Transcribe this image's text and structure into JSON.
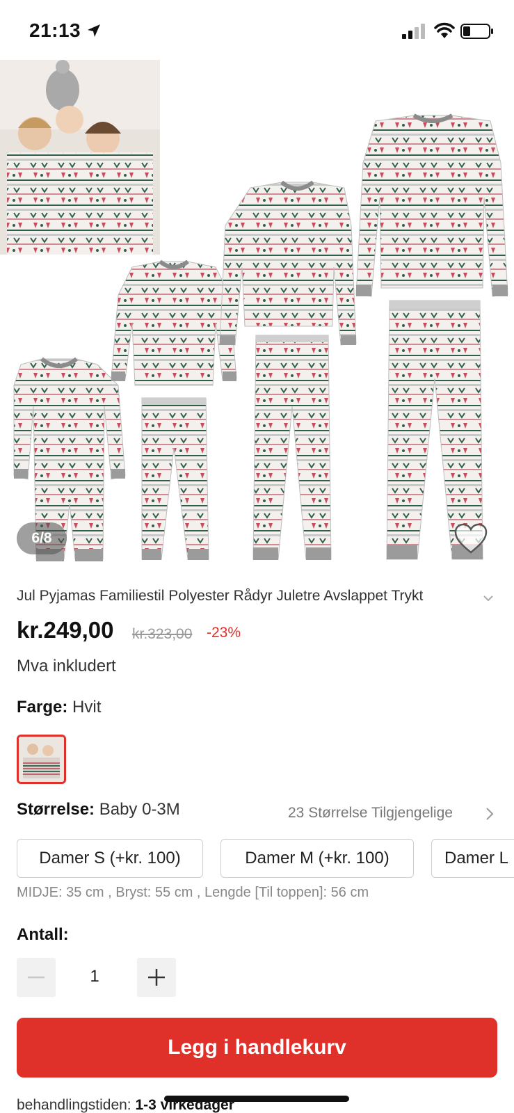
{
  "status_bar": {
    "time": "21:13",
    "icons": [
      "location-arrow-icon",
      "cellular-signal-icon",
      "wifi-icon",
      "battery-icon"
    ]
  },
  "gallery": {
    "counter": "6/8",
    "favorite_icon": "heart-icon"
  },
  "product": {
    "title": "Jul Pyjamas Familiestil Polyester Rådyr Juletre Avslappet Trykt",
    "price": "kr.249,00",
    "original_price": "kr.323,00",
    "discount": "-23%",
    "vat_note": "Mva inkludert"
  },
  "color": {
    "label": "Farge:",
    "value": "Hvit"
  },
  "size": {
    "label": "Størrelse:",
    "value": "Baby 0-3M",
    "availability": "23 Størrelse Tilgjengelige",
    "options": [
      "Damer S (+kr. 100)",
      "Damer M (+kr. 100)",
      "Damer L"
    ],
    "measurements": "MIDJE: 35 cm , Bryst: 55 cm , Lengde [Til toppen]: 56 cm"
  },
  "quantity": {
    "label": "Antall:",
    "value": "1"
  },
  "cart": {
    "button_label": "Legg i handlekurv"
  },
  "processing": {
    "label": "behandlingstiden:",
    "value": "1-3 virkedager"
  },
  "colors": {
    "accent": "#e0302a",
    "text": "#222222",
    "muted": "#888888"
  }
}
